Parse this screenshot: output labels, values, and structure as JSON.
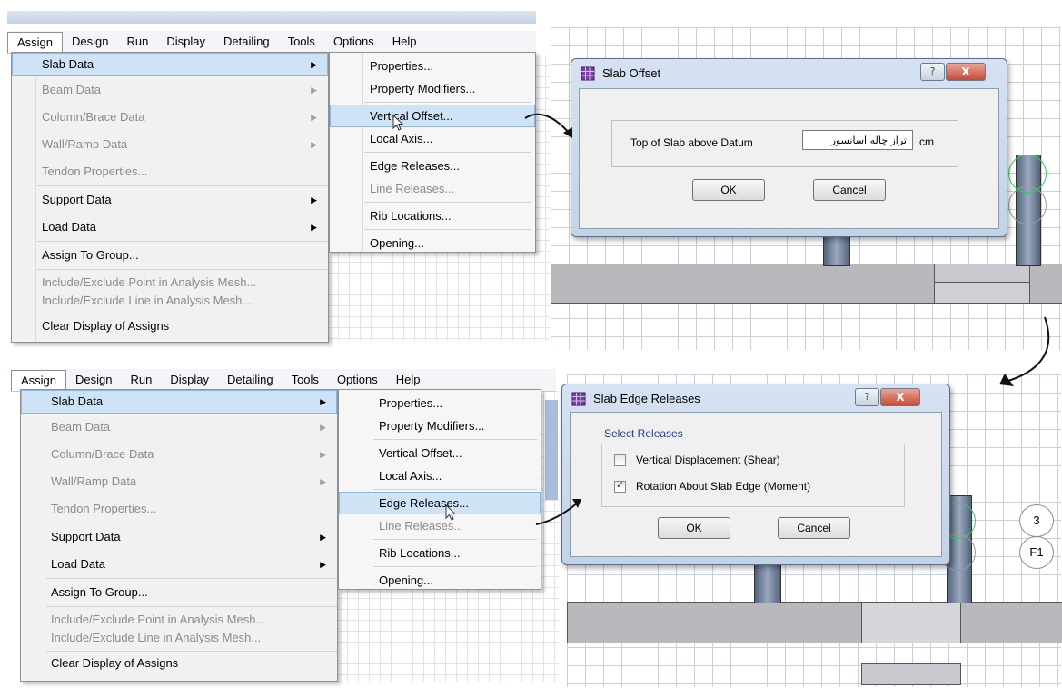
{
  "menubar": {
    "items": [
      "Assign",
      "Design",
      "Run",
      "Display",
      "Detailing",
      "Tools",
      "Options",
      "Help"
    ],
    "active": "Assign"
  },
  "assign_menu": {
    "slab_data": "Slab Data",
    "beam_data": "Beam Data",
    "column_brace_data": "Column/Brace Data",
    "wall_ramp_data": "Wall/Ramp Data",
    "tendon_properties": "Tendon Properties...",
    "support_data": "Support Data",
    "load_data": "Load Data",
    "assign_to_group": "Assign To Group...",
    "include_exclude_point": "Include/Exclude Point in Analysis Mesh...",
    "include_exclude_line": "Include/Exclude Line in Analysis Mesh...",
    "clear_display": "Clear Display of Assigns"
  },
  "slab_submenu": {
    "properties": "Properties...",
    "property_modifiers": "Property Modifiers...",
    "vertical_offset": "Vertical Offset...",
    "local_axis": "Local Axis...",
    "edge_releases": "Edge Releases...",
    "line_releases": "Line Releases...",
    "rib_locations": "Rib Locations...",
    "opening": "Opening..."
  },
  "slab_offset_dialog": {
    "title": "Slab Offset",
    "field_label": "Top of Slab above Datum",
    "field_value": "تراز چاله آسانسور",
    "unit": "cm",
    "ok": "OK",
    "cancel": "Cancel",
    "help_glyph": "?",
    "close_glyph": "X"
  },
  "edge_releases_dialog": {
    "title": "Slab Edge Releases",
    "group_label": "Select Releases",
    "option_shear": "Vertical Displacement (Shear)",
    "option_shear_checked": false,
    "option_moment": "Rotation About Slab Edge (Moment)",
    "option_moment_checked": true,
    "ok": "OK",
    "cancel": "Cancel",
    "help_glyph": "?",
    "close_glyph": "X"
  },
  "grid_bubbles": {
    "bubble_1": "3",
    "bubble_2": "F1"
  },
  "colors": {
    "menu_highlight": "#cfe3f7",
    "dialog_frame": "#c2d3e8",
    "close_button": "#c74a35",
    "grid_line": "#c9cfe0"
  }
}
